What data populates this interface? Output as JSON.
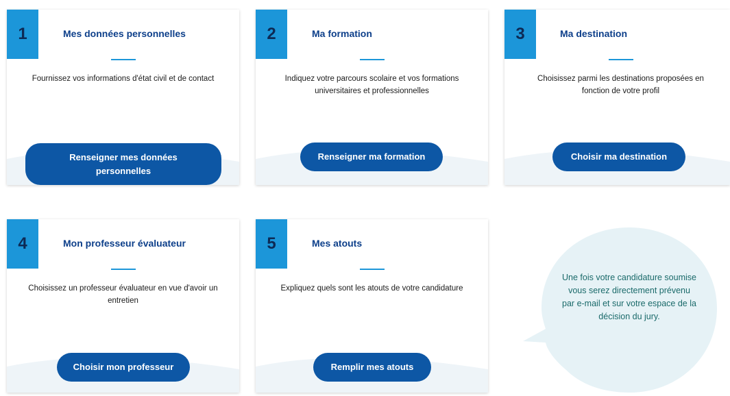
{
  "cards": [
    {
      "number": "1",
      "title": "Mes données personnelles",
      "description": "Fournissez vos informations d'état civil et de contact",
      "button": "Renseigner mes données personnelles"
    },
    {
      "number": "2",
      "title": "Ma formation",
      "description": "Indiquez votre parcours scolaire et vos formations universitaires et professionnelles",
      "button": "Renseigner ma formation"
    },
    {
      "number": "3",
      "title": "Ma destination",
      "description": "Choisissez parmi les destinations proposées en fonction de votre profil",
      "button": "Choisir ma destination"
    },
    {
      "number": "4",
      "title": "Mon professeur évaluateur",
      "description": "Choisissez un professeur évaluateur en vue d'avoir un entretien",
      "button": "Choisir mon professeur"
    },
    {
      "number": "5",
      "title": "Mes atouts",
      "description": "Expliquez quels sont les atouts de votre candidature",
      "button": "Remplir mes atouts"
    }
  ],
  "info_bubble": {
    "text": "Une fois votre candidature soumise vous serez directement prévenu par e-mail et sur votre espace de la décision du jury."
  },
  "colors": {
    "number_badge": "#1c96d9",
    "title": "#0d3f8a",
    "button": "#0d57a5",
    "bubble": "#e6f2f6",
    "bubble_text": "#1a6a6a"
  }
}
